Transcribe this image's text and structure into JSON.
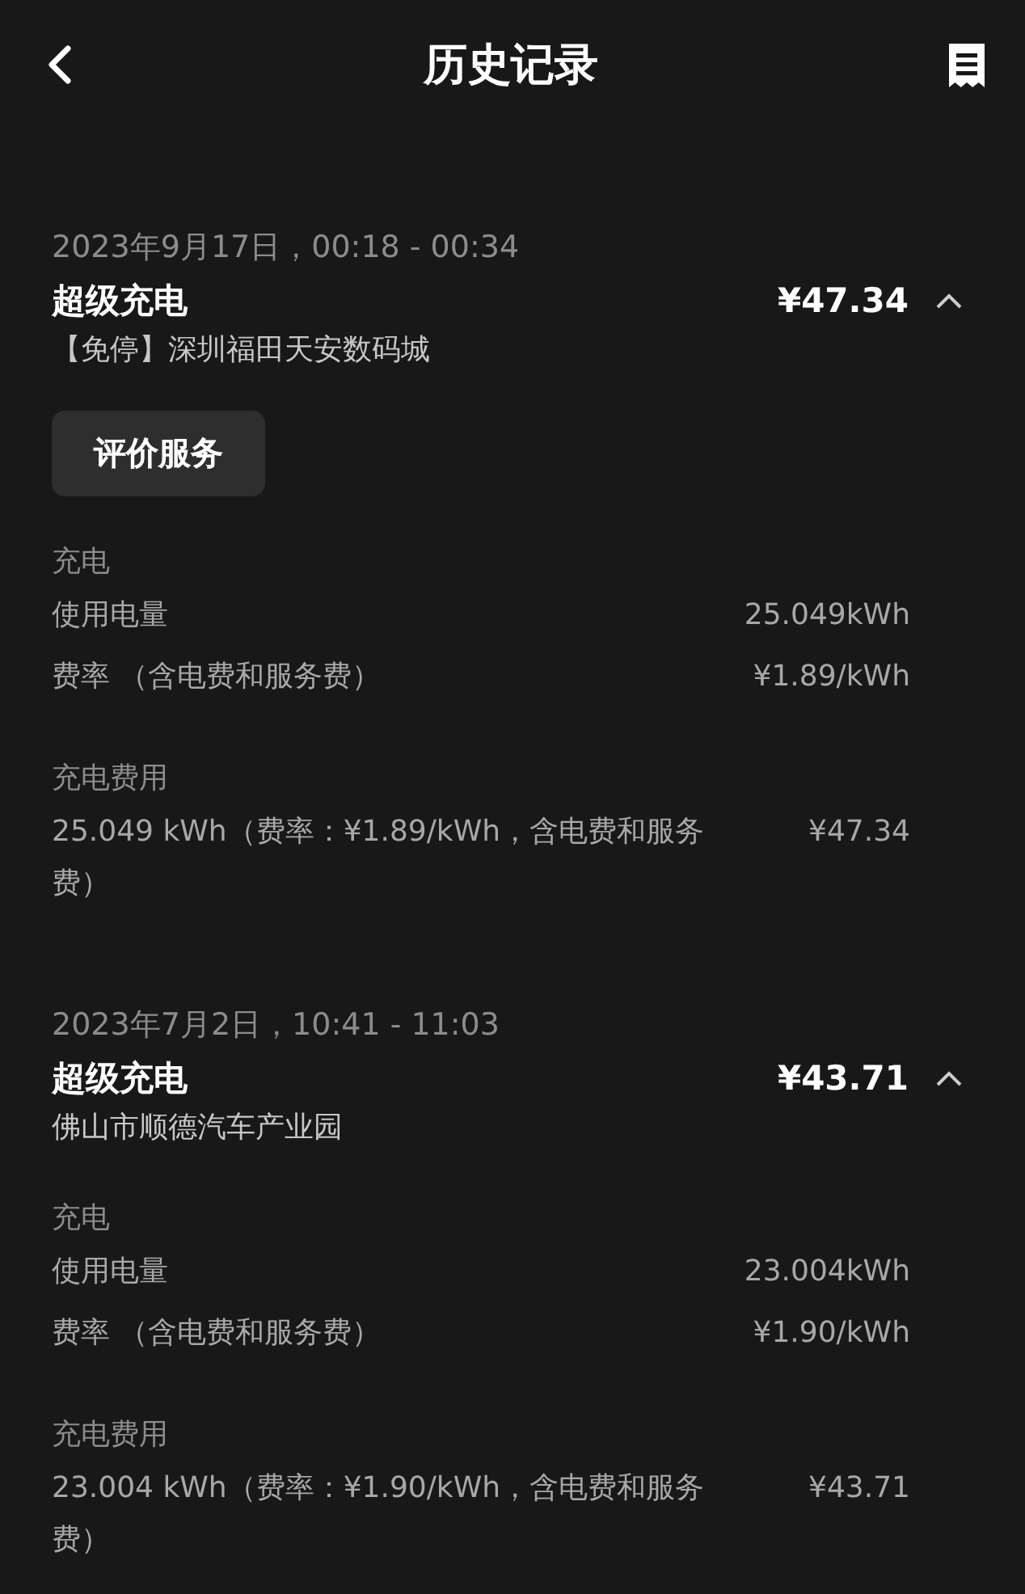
{
  "header": {
    "title": "历史记录"
  },
  "records": [
    {
      "time": "2023年9月17日，00:18 - 00:34",
      "title": "超级充电",
      "price": "¥47.34",
      "expanded": true,
      "location": "【免停】深圳福田天安数码城",
      "button": "评价服务",
      "sections": [
        {
          "heading": "充电",
          "rows": [
            {
              "label": "使用电量",
              "value": "25.049kWh"
            },
            {
              "label": "费率 （含电费和服务费）",
              "value": "¥1.89/kWh"
            }
          ]
        },
        {
          "heading": "充电费用",
          "rows": [
            {
              "label": "25.049 kWh（费率：¥1.89/kWh，含电费和服务费）",
              "value": "¥47.34"
            }
          ]
        }
      ]
    },
    {
      "time": "2023年7月2日，10:41 - 11:03",
      "title": "超级充电",
      "price": "¥43.71",
      "expanded": true,
      "location": "佛山市顺德汽车产业园",
      "sections": [
        {
          "heading": "充电",
          "rows": [
            {
              "label": "使用电量",
              "value": "23.004kWh"
            },
            {
              "label": "费率 （含电费和服务费）",
              "value": "¥1.90/kWh"
            }
          ]
        },
        {
          "heading": "充电费用",
          "rows": [
            {
              "label": "23.004 kWh（费率：¥1.90/kWh，含电费和服务费）",
              "value": "¥43.71"
            }
          ]
        }
      ]
    }
  ]
}
